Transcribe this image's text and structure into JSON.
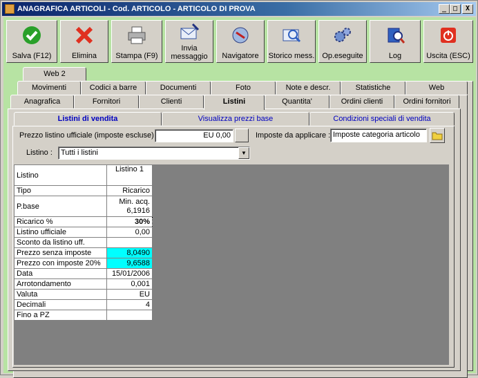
{
  "window": {
    "title": "ANAGRAFICA ARTICOLI - Cod. ARTICOLO - ARTICOLO DI PROVA",
    "controls": {
      "minimize": "_",
      "maximize": "□",
      "close": "X"
    }
  },
  "toolbar": {
    "buttons": [
      {
        "label": "Salva (F12)",
        "icon": "check-icon"
      },
      {
        "label": "Elimina",
        "icon": "delete-icon"
      },
      {
        "label": "Stampa (F9)",
        "icon": "printer-icon"
      },
      {
        "label": "Invia messaggio",
        "icon": "mail-icon"
      },
      {
        "label": "Navigatore",
        "icon": "compass-icon"
      },
      {
        "label": "Storico mess.",
        "icon": "search-mail-icon"
      },
      {
        "label": "Op.eseguite",
        "icon": "gears-icon"
      },
      {
        "label": "Log",
        "icon": "log-icon"
      },
      {
        "label": "Uscita (ESC)",
        "icon": "power-icon"
      }
    ]
  },
  "tabs": {
    "row1": [
      "Web 2"
    ],
    "row2": [
      "Movimenti",
      "Codici a barre",
      "Documenti",
      "Foto",
      "Note e descr.",
      "Statistiche",
      "Web"
    ],
    "row3": [
      "Anagrafica",
      "Fornitori",
      "Clienti",
      "Listini",
      "Quantita'",
      "Ordini clienti",
      "Ordini fornitori"
    ],
    "active": "Listini"
  },
  "subtabs": {
    "items": [
      "Listini di vendita",
      "Visualizza prezzi base",
      "Condizioni speciali di vendita"
    ],
    "active": "Listini di vendita"
  },
  "form": {
    "prezzo_label": "Prezzo listino ufficiale (imposte escluse) :",
    "prezzo_value": "EU 0,00",
    "imposte_label": "Imposte da applicare :",
    "imposte_value": "Imposte categoria articolo",
    "listino_label": "Listino :",
    "listino_value": "Tutti i listini"
  },
  "grid": {
    "header": {
      "label": "Listino",
      "column": "Listino 1"
    },
    "rows": [
      {
        "label": "Tipo",
        "value": "Ricarico"
      },
      {
        "label": "P.base",
        "value": "Min. acq.",
        "value2": "6,1916"
      },
      {
        "label": "Ricarico %",
        "value": "30%"
      },
      {
        "label": "Listino ufficiale",
        "value": "0,00"
      },
      {
        "label": "Sconto da listino uff.",
        "value": ""
      },
      {
        "label": "Prezzo senza imposte",
        "value": "8,0490"
      },
      {
        "label": "Prezzo con imposte 20%",
        "value": "9,6588"
      },
      {
        "label": "Data",
        "value": "15/01/2006"
      },
      {
        "label": "Arrotondamento",
        "value": "0,001"
      },
      {
        "label": "Valuta",
        "value": "EU"
      },
      {
        "label": "Decimali",
        "value": "4"
      },
      {
        "label": "Fino a PZ",
        "value": ""
      }
    ]
  },
  "colors": {
    "background": "#b7e3a3",
    "highlight": "#00ffff",
    "subtab_text": "#0000c0"
  }
}
